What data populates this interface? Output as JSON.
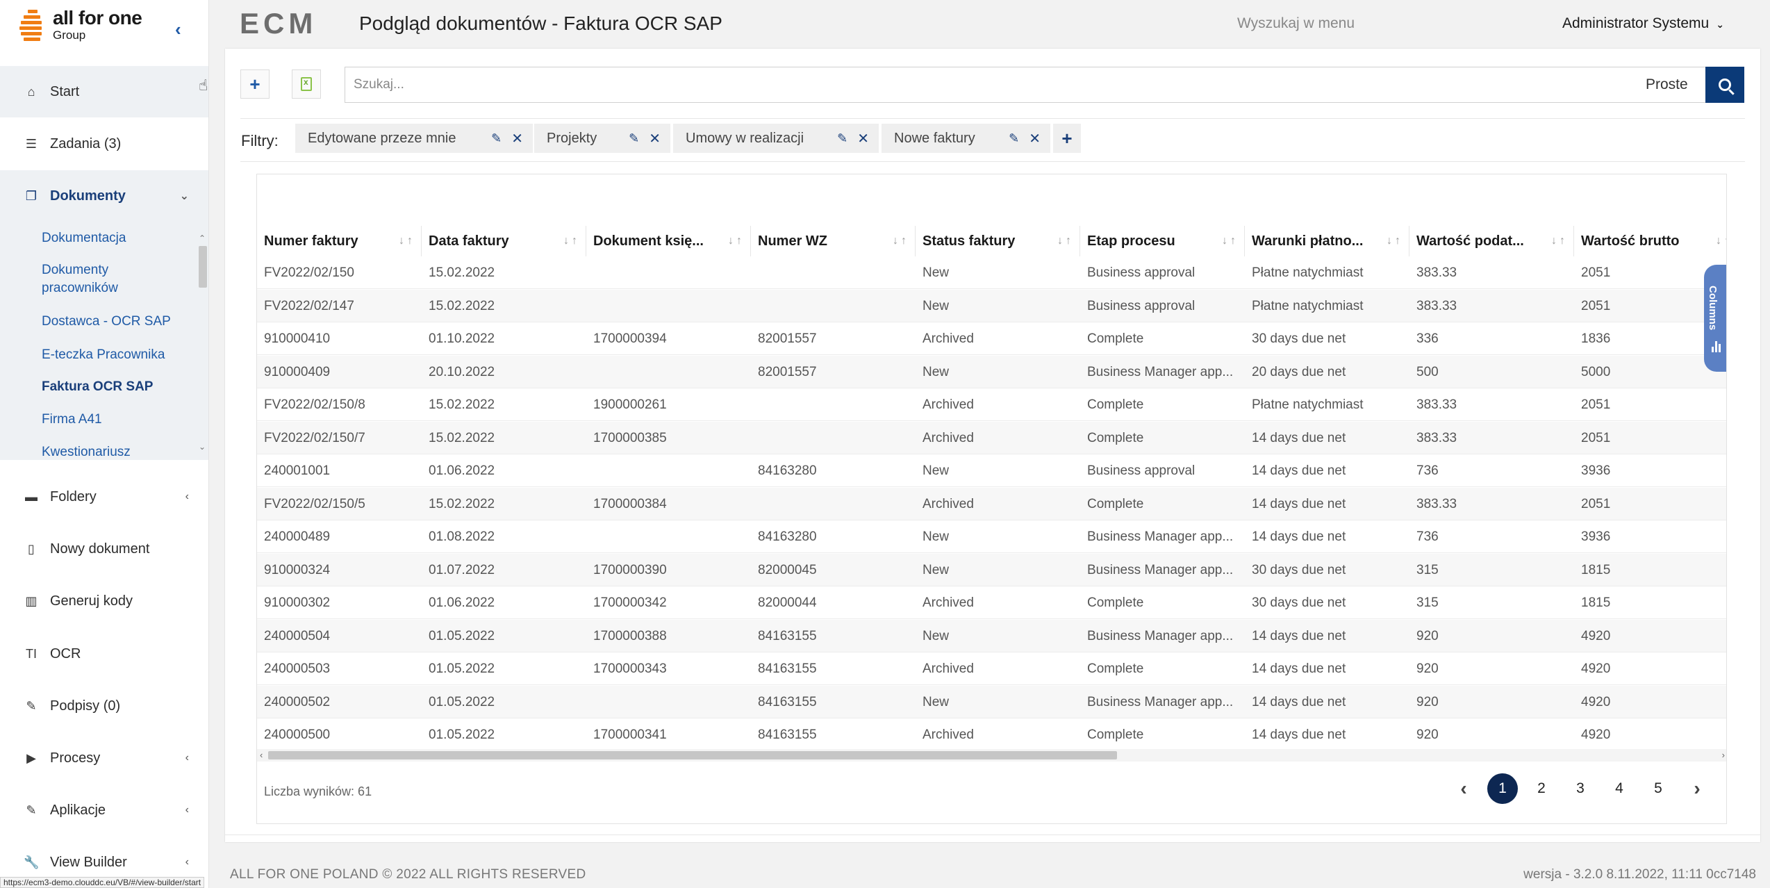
{
  "brand": {
    "name_line1": "all for one",
    "name_line2": "Group",
    "accent_color": "#f07d13"
  },
  "header": {
    "app_name": "ECM",
    "page_title": "Podgląd dokumentów - Faktura OCR SAP",
    "menu_search_placeholder": "Wyszukaj w menu",
    "user_name": "Administrator Systemu"
  },
  "sidebar": {
    "items": [
      {
        "label": "Start",
        "icon": "home-icon"
      },
      {
        "label": "Zadania (3)",
        "icon": "list-icon"
      },
      {
        "label": "Dokumenty",
        "icon": "documents-icon"
      },
      {
        "label": "Foldery",
        "icon": "folder-icon"
      },
      {
        "label": "Nowy dokument",
        "icon": "file-icon"
      },
      {
        "label": "Generuj kody",
        "icon": "barcode-icon"
      },
      {
        "label": "OCR",
        "icon": "text-icon"
      },
      {
        "label": "Podpisy (0)",
        "icon": "pencil-icon"
      },
      {
        "label": "Procesy",
        "icon": "play-icon"
      },
      {
        "label": "Aplikacje",
        "icon": "pencil-icon"
      },
      {
        "label": "View Builder",
        "icon": "wrench-icon"
      }
    ],
    "submenu": [
      "Dokumentacja",
      "Dokumenty pracowników",
      "Dostawca - OCR SAP",
      "E-teczka Pracownika",
      "Faktura OCR SAP",
      "Firma A41",
      "Kwestionariusz"
    ]
  },
  "toolbar": {
    "search_placeholder": "Szukaj...",
    "search_mode": "Proste"
  },
  "filters": {
    "label": "Filtry:",
    "chips": [
      "Edytowane przeze mnie",
      "Projekty",
      "Umowy w realizacji",
      "Nowe faktury"
    ]
  },
  "table": {
    "columns": [
      "Numer faktury",
      "Data faktury",
      "Dokument księ...",
      "Numer WZ",
      "Status faktury",
      "Etap procesu",
      "Warunki płatno...",
      "Wartość podat...",
      "Wartość brutto"
    ],
    "rows": [
      [
        "FV2022/02/150",
        "15.02.2022",
        "",
        "",
        "New",
        "Business approval",
        "Płatne natychmiast",
        "383.33",
        "2051"
      ],
      [
        "FV2022/02/147",
        "15.02.2022",
        "",
        "",
        "New",
        "Business approval",
        "Płatne natychmiast",
        "383.33",
        "2051"
      ],
      [
        "910000410",
        "01.10.2022",
        "1700000394",
        "82001557",
        "Archived",
        "Complete",
        "30 days due net",
        "336",
        "1836"
      ],
      [
        "910000409",
        "20.10.2022",
        "",
        "82001557",
        "New",
        "Business Manager app...",
        "20 days due net",
        "500",
        "5000"
      ],
      [
        "FV2022/02/150/8",
        "15.02.2022",
        "1900000261",
        "",
        "Archived",
        "Complete",
        "Płatne natychmiast",
        "383.33",
        "2051"
      ],
      [
        "FV2022/02/150/7",
        "15.02.2022",
        "1700000385",
        "",
        "Archived",
        "Complete",
        "14 days due net",
        "383.33",
        "2051"
      ],
      [
        "240001001",
        "01.06.2022",
        "",
        "84163280",
        "New",
        "Business approval",
        "14 days due net",
        "736",
        "3936"
      ],
      [
        "FV2022/02/150/5",
        "15.02.2022",
        "1700000384",
        "",
        "Archived",
        "Complete",
        "14 days due net",
        "383.33",
        "2051"
      ],
      [
        "240000489",
        "01.08.2022",
        "",
        "84163280",
        "New",
        "Business Manager app...",
        "14 days due net",
        "736",
        "3936"
      ],
      [
        "910000324",
        "01.07.2022",
        "1700000390",
        "82000045",
        "New",
        "Business Manager app...",
        "30 days due net",
        "315",
        "1815"
      ],
      [
        "910000302",
        "01.06.2022",
        "1700000342",
        "82000044",
        "Archived",
        "Complete",
        "30 days due net",
        "315",
        "1815"
      ],
      [
        "240000504",
        "01.05.2022",
        "1700000388",
        "84163155",
        "New",
        "Business Manager app...",
        "14 days due net",
        "920",
        "4920"
      ],
      [
        "240000503",
        "01.05.2022",
        "1700000343",
        "84163155",
        "Archived",
        "Complete",
        "14 days due net",
        "920",
        "4920"
      ],
      [
        "240000502",
        "01.05.2022",
        "",
        "84163155",
        "New",
        "Business Manager app...",
        "14 days due net",
        "920",
        "4920"
      ],
      [
        "240000500",
        "01.05.2022",
        "1700000341",
        "84163155",
        "Archived",
        "Complete",
        "14 days due net",
        "920",
        "4920"
      ]
    ],
    "columns_panel_label": "Columns",
    "result_count": "Liczba wyników: 61",
    "pages": [
      "1",
      "2",
      "3",
      "4",
      "5"
    ],
    "current_page": "1"
  },
  "footer": {
    "copyright": "ALL FOR ONE POLAND © 2022 ALL RIGHTS RESERVED",
    "version": "wersja - 3.2.0 8.11.2022, 11:11 0cc7148"
  },
  "status_bar_url": "https://ecm3-demo.clouddc.eu/VB/#/view-builder/start"
}
